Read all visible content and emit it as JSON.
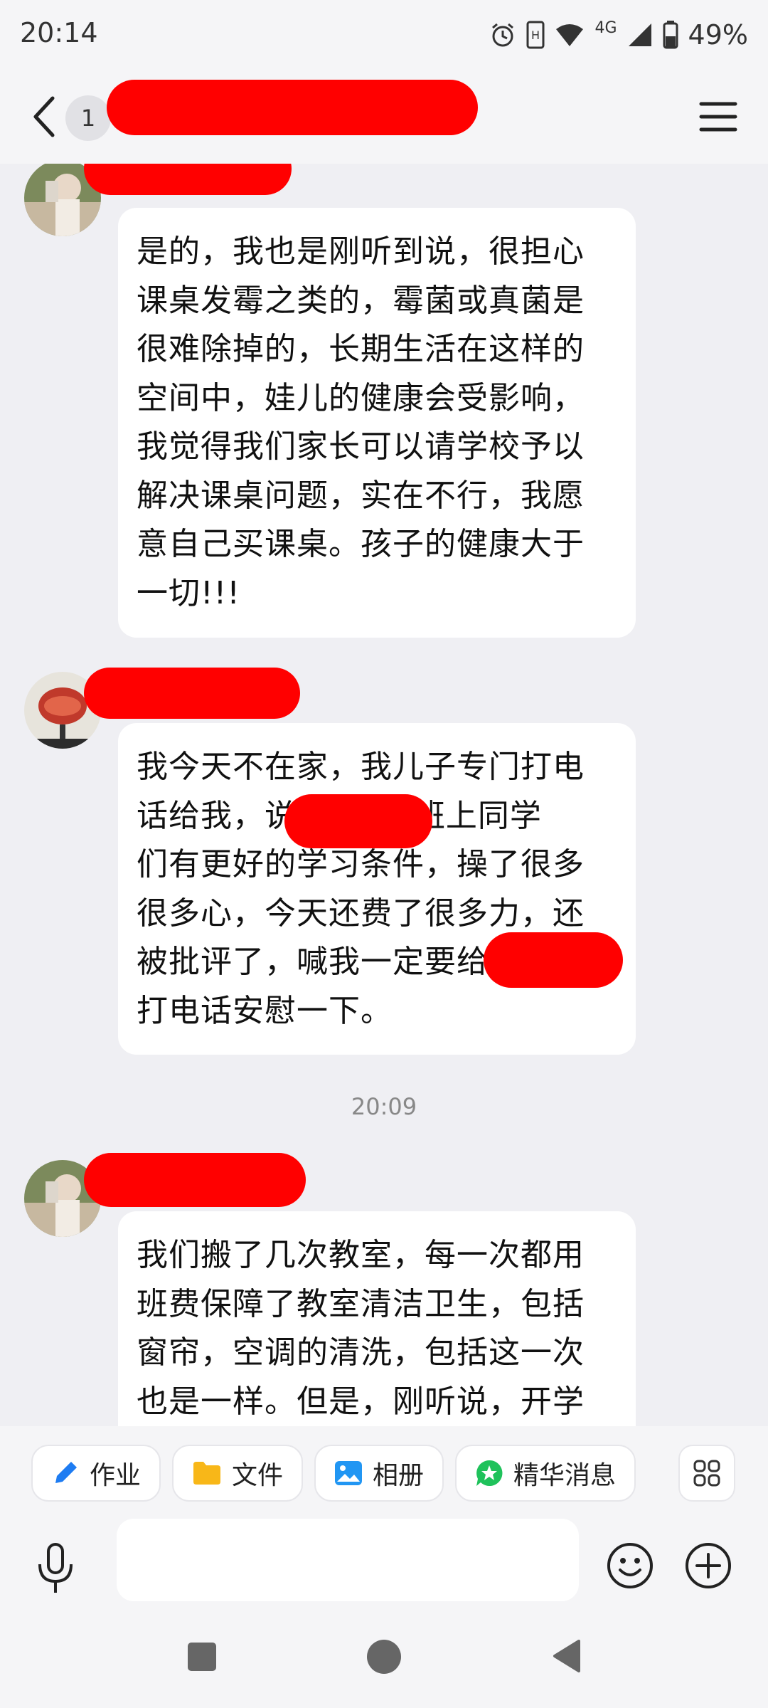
{
  "status": {
    "time": "20:14",
    "network": "4G",
    "battery": "49%"
  },
  "header": {
    "unread_count": "1",
    "icons": [
      "back-arrow-icon",
      "menu-icon"
    ]
  },
  "messages": [
    {
      "text": "是的，我也是刚听到说，很担心\n课桌发霉之类的，霉菌或真菌是\n很难除掉的，长期生活在这样的\n空间中，娃儿的健康会受影响，\n我觉得我们家长可以请学校予以\n解决课桌问题，实在不行，我愿\n意自己买课桌。孩子的健康大于\n一切!!!"
    },
    {
      "text": "我今天不在家，我儿子专门打电\n话给我，说        了班上同学\n们有更好的学习条件，操了很多\n很多心，今天还费了很多力，还\n被批评了，喊我一定要给\n打电话安慰一下。"
    },
    {
      "text": "我们搬了几次教室，每一次都用\n班费保障了教室清洁卫生，包括\n窗帘，空调的清洗，包括这一次\n也是一样。但是，刚听说，开学"
    }
  ],
  "timestamp": "20:09",
  "toolbar": {
    "chips": [
      {
        "label": "作业",
        "icon": "pen-icon",
        "color": "#1e7cf2"
      },
      {
        "label": "文件",
        "icon": "folder-icon",
        "color": "#f8b718"
      },
      {
        "label": "相册",
        "icon": "picture-icon",
        "color": "#2196f3"
      },
      {
        "label": "精华消息",
        "icon": "star-chat-icon",
        "color": "#1fc25b"
      }
    ]
  },
  "colors": {
    "redaction": "#ff0000",
    "background": "#efeff3",
    "bubble": "#ffffff"
  }
}
